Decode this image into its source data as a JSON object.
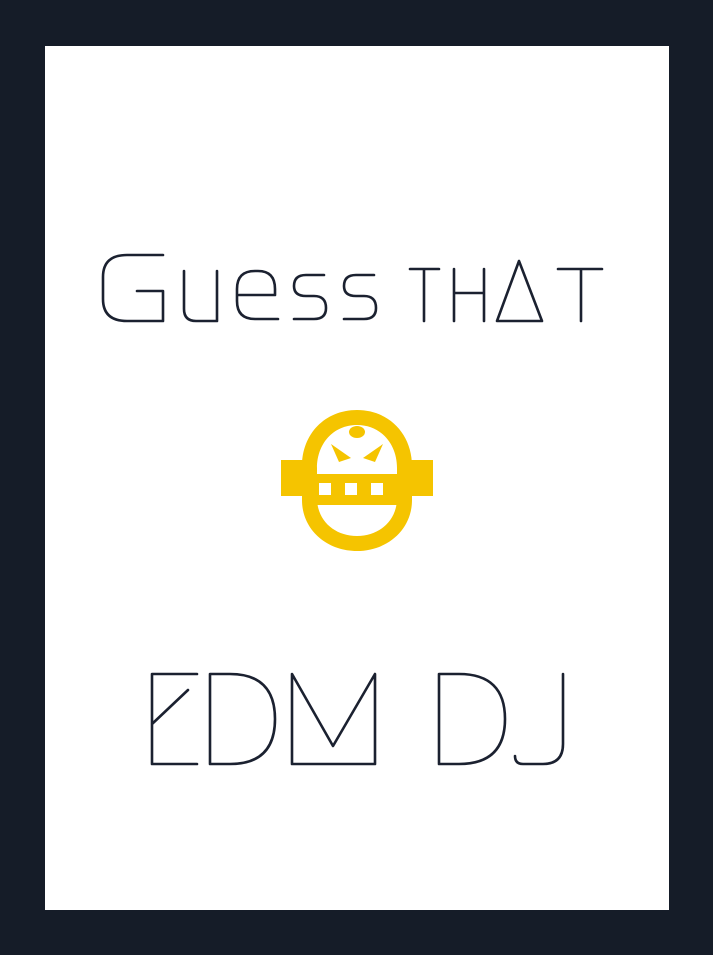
{
  "title": {
    "line1": "Guess that",
    "line2": "EDM DJ"
  },
  "logo": {
    "icon": "robot-helmet-icon",
    "color": "#f5c400"
  },
  "colors": {
    "frame": "#151c28",
    "card": "#ffffff",
    "ink": "#1b2130",
    "accent": "#f5c400"
  }
}
